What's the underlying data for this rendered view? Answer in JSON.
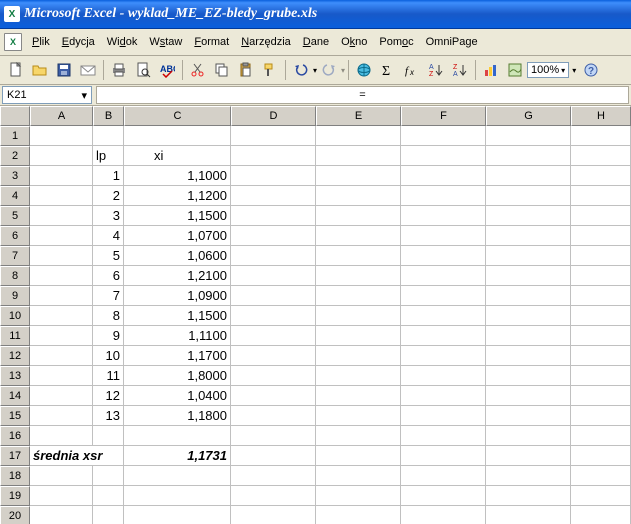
{
  "window": {
    "title": "Microsoft Excel - wyklad_ME_EZ-bledy_grube.xls",
    "app_icon": "X"
  },
  "menu": {
    "items": [
      "Plik",
      "Edycja",
      "Widok",
      "Wstaw",
      "Format",
      "Narzędzia",
      "Dane",
      "Okno",
      "Pomoc",
      "OmniPage"
    ],
    "underline": [
      0,
      0,
      2,
      1,
      0,
      0,
      0,
      1,
      3,
      null
    ]
  },
  "toolbar": {
    "zoom": "100%"
  },
  "formulabar": {
    "namebox": "K21",
    "fx": "="
  },
  "grid": {
    "columns": [
      "A",
      "B",
      "C",
      "D",
      "E",
      "F",
      "G",
      "H"
    ],
    "widths": [
      "w-A",
      "w-B",
      "w-C",
      "w-D",
      "w-E",
      "w-F",
      "w-G",
      "w-H"
    ],
    "row_count": 20,
    "cells": {
      "B2": {
        "v": "lp",
        "align": "l"
      },
      "C2": {
        "v": "xi",
        "align": "l",
        "indent": true
      },
      "B3": {
        "v": "1",
        "align": "r"
      },
      "C3": {
        "v": "1,1000",
        "align": "r"
      },
      "B4": {
        "v": "2",
        "align": "r"
      },
      "C4": {
        "v": "1,1200",
        "align": "r"
      },
      "B5": {
        "v": "3",
        "align": "r"
      },
      "C5": {
        "v": "1,1500",
        "align": "r"
      },
      "B6": {
        "v": "4",
        "align": "r"
      },
      "C6": {
        "v": "1,0700",
        "align": "r"
      },
      "B7": {
        "v": "5",
        "align": "r"
      },
      "C7": {
        "v": "1,0600",
        "align": "r"
      },
      "B8": {
        "v": "6",
        "align": "r"
      },
      "C8": {
        "v": "1,2100",
        "align": "r"
      },
      "B9": {
        "v": "7",
        "align": "r"
      },
      "C9": {
        "v": "1,0900",
        "align": "r"
      },
      "B10": {
        "v": "8",
        "align": "r"
      },
      "C10": {
        "v": "1,1500",
        "align": "r"
      },
      "B11": {
        "v": "9",
        "align": "r"
      },
      "C11": {
        "v": "1,1100",
        "align": "r"
      },
      "B12": {
        "v": "10",
        "align": "r"
      },
      "C12": {
        "v": "1,1700",
        "align": "r"
      },
      "B13": {
        "v": "11",
        "align": "r"
      },
      "C13": {
        "v": "1,8000",
        "align": "r"
      },
      "B14": {
        "v": "12",
        "align": "r"
      },
      "C14": {
        "v": "1,0400",
        "align": "r"
      },
      "B15": {
        "v": "13",
        "align": "r"
      },
      "C15": {
        "v": "1,1800",
        "align": "r"
      },
      "A17": {
        "v": "średnia xsr",
        "align": "l",
        "bold": true,
        "span": 2
      },
      "C17": {
        "v": "1,1731",
        "align": "r",
        "bold": true
      }
    }
  }
}
